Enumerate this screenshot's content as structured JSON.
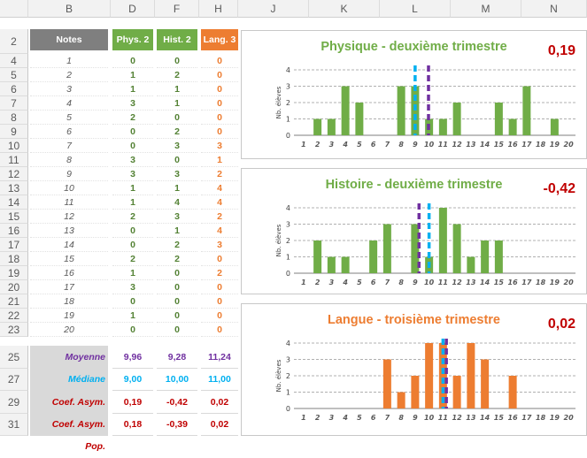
{
  "columns": [
    "B",
    "D",
    "F",
    "H",
    "J",
    "K",
    "L",
    "M",
    "N"
  ],
  "rows": [
    "2",
    "4",
    "5",
    "6",
    "7",
    "8",
    "9",
    "10",
    "11",
    "12",
    "13",
    "14",
    "15",
    "16",
    "17",
    "18",
    "19",
    "20",
    "21",
    "22",
    "23",
    "25",
    "27",
    "29",
    "31"
  ],
  "table": {
    "headers": {
      "notes": "Notes",
      "phys": "Phys. 2",
      "hist": "Hist. 2",
      "lang": "Lang. 3"
    },
    "data": [
      [
        "1",
        "0",
        "0",
        "0"
      ],
      [
        "2",
        "1",
        "2",
        "0"
      ],
      [
        "3",
        "1",
        "1",
        "0"
      ],
      [
        "4",
        "3",
        "1",
        "0"
      ],
      [
        "5",
        "2",
        "0",
        "0"
      ],
      [
        "6",
        "0",
        "2",
        "0"
      ],
      [
        "7",
        "0",
        "3",
        "3"
      ],
      [
        "8",
        "3",
        "0",
        "1"
      ],
      [
        "9",
        "3",
        "3",
        "2"
      ],
      [
        "10",
        "1",
        "1",
        "4"
      ],
      [
        "11",
        "1",
        "4",
        "4"
      ],
      [
        "12",
        "2",
        "3",
        "2"
      ],
      [
        "13",
        "0",
        "1",
        "4"
      ],
      [
        "14",
        "0",
        "2",
        "3"
      ],
      [
        "15",
        "2",
        "2",
        "0"
      ],
      [
        "16",
        "1",
        "0",
        "2"
      ],
      [
        "17",
        "3",
        "0",
        "0"
      ],
      [
        "18",
        "0",
        "0",
        "0"
      ],
      [
        "19",
        "1",
        "0",
        "0"
      ],
      [
        "20",
        "0",
        "0",
        "0"
      ]
    ],
    "stats": [
      {
        "label": "Moyenne",
        "values": [
          "9,96",
          "9,28",
          "11,24"
        ],
        "color": "#7030a0"
      },
      {
        "label": "Médiane",
        "values": [
          "9,00",
          "10,00",
          "11,00"
        ],
        "color": "#00b0f0"
      },
      {
        "label": "Coef. Asym. Éch.",
        "values": [
          "0,19",
          "-0,42",
          "0,02"
        ],
        "color": "#c00000"
      },
      {
        "label": "Coef. Asym. Pop.",
        "values": [
          "0,18",
          "-0,39",
          "0,02"
        ],
        "color": "#c00000"
      }
    ]
  },
  "colors": {
    "header_gray": "#7f7f7f",
    "phys": "#70ad47",
    "hist": "#70ad47",
    "lang": "#ed7d31",
    "green_text": "#548235",
    "orange_text": "#ed7d31"
  },
  "chart_data": [
    {
      "type": "bar",
      "title": "Physique - deuxième trimestre",
      "value_label": "0,19",
      "ylabel": "Nb. élèves",
      "categories": [
        "1",
        "2",
        "3",
        "4",
        "5",
        "6",
        "7",
        "8",
        "9",
        "10",
        "11",
        "12",
        "13",
        "14",
        "15",
        "16",
        "17",
        "18",
        "19",
        "20"
      ],
      "values": [
        0,
        1,
        1,
        3,
        2,
        0,
        0,
        3,
        3,
        1,
        1,
        2,
        0,
        0,
        2,
        1,
        3,
        0,
        1,
        0
      ],
      "ylim": [
        0,
        4
      ],
      "mean": 9.96,
      "median": 9,
      "color": "#70ad47",
      "title_color": "#70ad47"
    },
    {
      "type": "bar",
      "title": "Histoire - deuxième trimestre",
      "value_label": "-0,42",
      "ylabel": "Nb. élèves",
      "categories": [
        "1",
        "2",
        "3",
        "4",
        "5",
        "6",
        "7",
        "8",
        "9",
        "10",
        "11",
        "12",
        "13",
        "14",
        "15",
        "16",
        "17",
        "18",
        "19",
        "20"
      ],
      "values": [
        0,
        2,
        1,
        1,
        0,
        2,
        3,
        0,
        3,
        1,
        4,
        3,
        1,
        2,
        2,
        0,
        0,
        0,
        0,
        0
      ],
      "ylim": [
        0,
        4
      ],
      "mean": 9.28,
      "median": 10,
      "color": "#70ad47",
      "title_color": "#70ad47"
    },
    {
      "type": "bar",
      "title": "Langue - troisième trimestre",
      "value_label": "0,02",
      "ylabel": "Nb. élèves",
      "categories": [
        "1",
        "2",
        "3",
        "4",
        "5",
        "6",
        "7",
        "8",
        "9",
        "10",
        "11",
        "12",
        "13",
        "14",
        "15",
        "16",
        "17",
        "18",
        "19",
        "20"
      ],
      "values": [
        0,
        0,
        0,
        0,
        0,
        0,
        3,
        1,
        2,
        4,
        4,
        2,
        4,
        3,
        0,
        2,
        0,
        0,
        0,
        0
      ],
      "ylim": [
        0,
        4
      ],
      "mean": 11.24,
      "median": 11,
      "color": "#ed7d31",
      "title_color": "#ed7d31"
    }
  ]
}
